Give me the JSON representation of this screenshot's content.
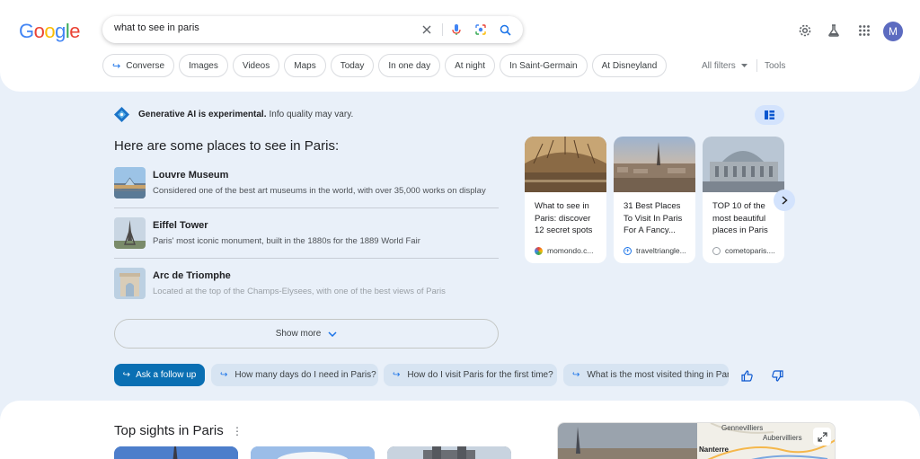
{
  "search": {
    "query": "what to see in paris"
  },
  "profile": {
    "initial": "M",
    "color": "#5c6bc0"
  },
  "chips": {
    "converse": "Converse",
    "items": [
      "Images",
      "Videos",
      "Maps",
      "Today",
      "In one day",
      "At night",
      "In Saint-Germain",
      "At Disneyland"
    ],
    "all_filters": "All filters",
    "tools": "Tools"
  },
  "ai": {
    "experimental_bold": "Generative AI is experimental.",
    "experimental_note": "Info quality may vary.",
    "heading": "Here are some places to see in Paris:",
    "places": [
      {
        "name": "Louvre Museum",
        "desc": "Considered one of the best art museums in the world, with over 35,000 works on display"
      },
      {
        "name": "Eiffel Tower",
        "desc": "Paris' most iconic monument, built in the 1880s for the 1889 World Fair"
      },
      {
        "name": "Arc de Triomphe",
        "desc": "Located at the top of the Champs-Elysees, with one of the best views of Paris"
      }
    ],
    "show_more": "Show more",
    "cards": [
      {
        "title": "What to see in Paris: discover 12 secret spots",
        "source": "momondo.c..."
      },
      {
        "title": "31 Best Places To Visit In Paris For A Fancy...",
        "source": "traveltriangle..."
      },
      {
        "title": "TOP 10 of the most beautiful places in Paris",
        "source": "cometoparis...."
      }
    ],
    "ask_follow_up": "Ask a follow up",
    "suggestions": [
      "How many days do I need in Paris?",
      "How do I visit Paris for the first time?",
      "What is the most visited thing in Paris"
    ]
  },
  "top_sights": {
    "title": "Top sights in Paris",
    "map_labels": [
      "Gennevilliers",
      "Aubervilliers",
      "Nanterre"
    ]
  },
  "colors": {
    "accent": "#1a73e8",
    "background": "#e9f0f9",
    "chip_border": "#dadce0"
  }
}
